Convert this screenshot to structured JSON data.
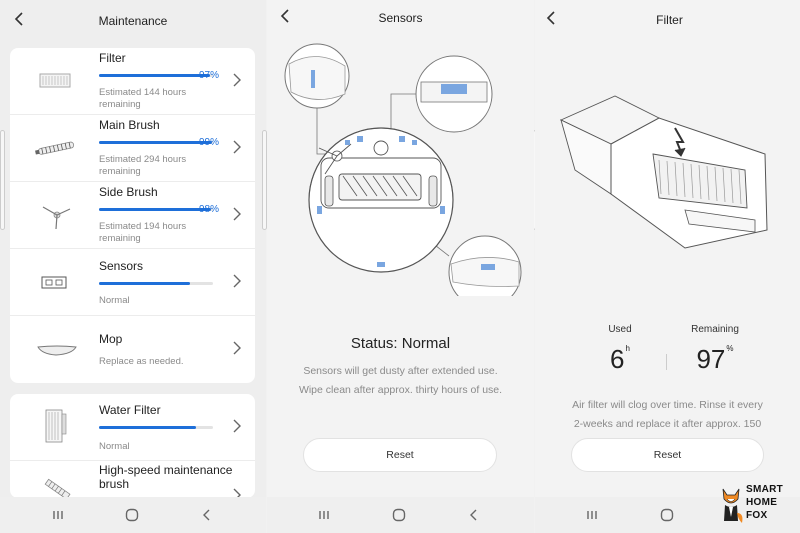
{
  "maintenance": {
    "title": "Maintenance",
    "items": [
      {
        "name": "Filter",
        "percent": "97%",
        "level": 0.97,
        "sub": "Estimated 144 hours remaining",
        "icon": "filter-icon"
      },
      {
        "name": "Main Brush",
        "percent": "99%",
        "level": 0.99,
        "sub": "Estimated 294 hours remaining",
        "icon": "main-brush-icon"
      },
      {
        "name": "Side Brush",
        "percent": "98%",
        "level": 0.98,
        "sub": "Estimated 194 hours remaining",
        "icon": "side-brush-icon"
      },
      {
        "name": "Sensors",
        "percent": "",
        "level": 0.8,
        "sub": "Normal",
        "icon": "sensor-icon"
      },
      {
        "name": "Mop",
        "percent": "",
        "level": null,
        "sub": "Replace as needed.",
        "icon": "mop-icon"
      }
    ],
    "items2": [
      {
        "name": "Water Filter",
        "percent": "",
        "level": 0.85,
        "sub": "Normal",
        "icon": "water-filter-icon"
      },
      {
        "name": "High-speed maintenance brush",
        "percent": "",
        "level": null,
        "sub": "",
        "icon": "maintenance-brush-icon"
      }
    ]
  },
  "sensors": {
    "title": "Sensors",
    "status": "Status:  Normal",
    "desc_line1": "Sensors will get dusty after extended use.",
    "desc_line2": "Wipe clean after approx. thirty hours of use.",
    "reset_label": "Reset"
  },
  "filter": {
    "title": "Filter",
    "used_label": "Used",
    "used_value": "6",
    "used_unit": "h",
    "remaining_label": "Remaining",
    "remaining_value": "97",
    "remaining_unit": "%",
    "desc_line1": "Air filter will clog over time. Rinse it every",
    "desc_line2": "2-weeks and replace it after approx. 150",
    "reset_label": "Reset"
  },
  "logo": {
    "line1": "SMART",
    "line2": "HOME",
    "line3": "FOX"
  },
  "colors": {
    "accent": "#1e6fd9",
    "card": "#ffffff",
    "background": "#eeeeee"
  }
}
